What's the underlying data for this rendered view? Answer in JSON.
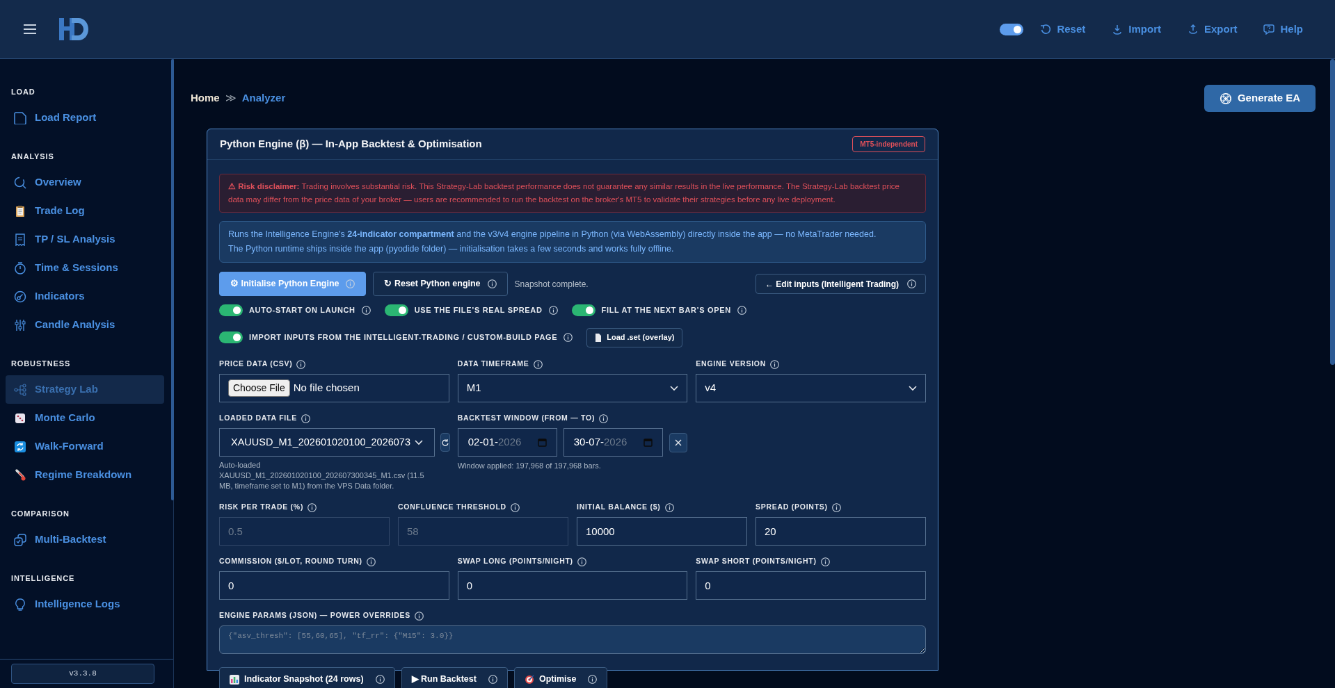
{
  "header": {
    "theme_toggle": {
      "on": true
    },
    "actions": [
      {
        "label": "Reset"
      },
      {
        "label": "Import"
      },
      {
        "label": "Export"
      },
      {
        "label": "Help"
      }
    ]
  },
  "sidebar": {
    "sections": [
      {
        "title": "LOAD",
        "items": [
          {
            "label": "Load Report",
            "selected": false
          }
        ]
      },
      {
        "title": "ANALYSIS",
        "items": [
          {
            "label": "Overview",
            "selected": false
          },
          {
            "label": "Trade Log",
            "selected": false
          },
          {
            "label": "TP / SL Analysis",
            "selected": false
          },
          {
            "label": "Time & Sessions",
            "selected": false
          },
          {
            "label": "Indicators",
            "selected": false
          },
          {
            "label": "Candle Analysis",
            "selected": false
          }
        ]
      },
      {
        "title": "ROBUSTNESS",
        "items": [
          {
            "label": "Strategy Lab",
            "selected": true
          },
          {
            "label": "Monte Carlo",
            "selected": false
          },
          {
            "label": "Walk-Forward",
            "selected": false
          },
          {
            "label": "Regime Breakdown",
            "selected": false
          }
        ]
      },
      {
        "title": "COMPARISON",
        "items": [
          {
            "label": "Multi-Backtest",
            "selected": false
          }
        ]
      },
      {
        "title": "INTELLIGENCE",
        "items": [
          {
            "label": "Intelligence Logs",
            "selected": false
          }
        ]
      }
    ],
    "version": "v3.3.8"
  },
  "breadcrumb": {
    "items": [
      "Home",
      "Analyzer"
    ],
    "separator": "≫"
  },
  "generate_button": "Generate EA",
  "panel": {
    "title": "Python Engine (β) — In-App Backtest & Optimisation",
    "badge": "MT5-independent",
    "disclaimer": "**⚠ Risk disclaimer:** Trading involves substantial risk. This Strategy-Lab backtest performance does not guarantee any similar results in the live performance. The Strategy-Lab backtest price data may differ from the price data of your broker — users are recommended to run the backtest on the broker's MT5 to validate their strategies before any live deployment.",
    "info": [
      "Runs the Intelligence Engine's **24-indicator compartment** and the v3/v4 engine pipeline in Python (via WebAssembly) directly inside the app — no MetaTrader needed.",
      "The Python runtime ships inside the app (pyodide folder) — initialisation takes a few seconds and works fully offline."
    ],
    "engine_buttons": [
      {
        "label": "⚙ Initialise Python Engine",
        "kind": "primary"
      },
      {
        "label": "↻ Reset Python engine",
        "kind": "secondary"
      }
    ],
    "status": "Snapshot complete.",
    "edit_button": "← Edit inputs (Intelligent Trading)",
    "toggle_rows": [
      {
        "toggles": [
          {
            "label": "AUTO-START ON LAUNCH",
            "on": true
          },
          {
            "label": "USE THE FILE’S REAL SPREAD",
            "on": true
          },
          {
            "label": "FILL AT THE NEXT BAR’S OPEN",
            "on": true
          }
        ]
      },
      {
        "toggles": [
          {
            "label": "IMPORT INPUTS FROM THE INTELLIGENT-TRADING / CUSTOM-BUILD PAGE",
            "on": true
          }
        ],
        "button": "Load .set (overlay)"
      }
    ],
    "field_rows": [
      {
        "kind": "three_column",
        "fields": [
          {
            "kind": "file",
            "label": "PRICE DATA (CSV)",
            "button": "Choose File",
            "value": "No file chosen"
          },
          {
            "kind": "select",
            "label": "DATA TIMEFRAME",
            "value": "M1"
          },
          {
            "kind": "select",
            "label": "ENGINE VERSION",
            "value": "v4"
          }
        ]
      },
      {
        "kind": "three_column",
        "fields": [
          {
            "kind": "file_select",
            "label": "LOADED DATA FILE",
            "value": "XAUUSD_M1_202601020100_2026073",
            "note": "Auto-loaded XAUUSD_M1_202601020100_202607300345_M1.csv (11.5 MB, timeframe set to M1) from the VPS Data folder."
          },
          {
            "kind": "date_range",
            "label": "BACKTEST WINDOW (FROM — TO)",
            "from": {
              "day_month": "02-01-",
              "year": "2026"
            },
            "to": {
              "day_month": "30-07-",
              "year": "2026"
            },
            "note": "Window applied: 197,968 of 197,968 bars."
          }
        ]
      },
      {
        "kind": "four_column",
        "fields": [
          {
            "kind": "text",
            "label": "RISK PER TRADE (%)",
            "value": "0.5",
            "disabled": true
          },
          {
            "kind": "text",
            "label": "CONFLUENCE THRESHOLD",
            "value": "58",
            "disabled": true
          },
          {
            "kind": "text",
            "label": "INITIAL BALANCE ($)",
            "value": "10000",
            "disabled": false
          },
          {
            "kind": "text",
            "label": "SPREAD (POINTS)",
            "value": "20",
            "disabled": false
          }
        ]
      },
      {
        "kind": "three_column",
        "fields": [
          {
            "kind": "text",
            "label": "COMMISSION ($/LOT, ROUND TURN)",
            "value": "0",
            "disabled": false
          },
          {
            "kind": "text",
            "label": "SWAP LONG (POINTS/NIGHT)",
            "value": "0",
            "disabled": false
          },
          {
            "kind": "text",
            "label": "SWAP SHORT (POINTS/NIGHT)",
            "value": "0",
            "disabled": false
          }
        ]
      },
      {
        "kind": "full_width",
        "fields": [
          {
            "kind": "textarea",
            "label": "ENGINE PARAMS (JSON) — POWER OVERRIDES",
            "placeholder": "{\"asv_thresh\": [55,60,65], \"tf_rr\": {\"M15\": 3.0}}"
          }
        ]
      }
    ],
    "run_buttons": [
      {
        "label": "Indicator Snapshot (24 rows)",
        "kind": "snapshot"
      },
      {
        "label": "▶ Run Backtest",
        "kind": "run"
      },
      {
        "label": "Optimise",
        "kind": "optimise"
      }
    ]
  }
}
